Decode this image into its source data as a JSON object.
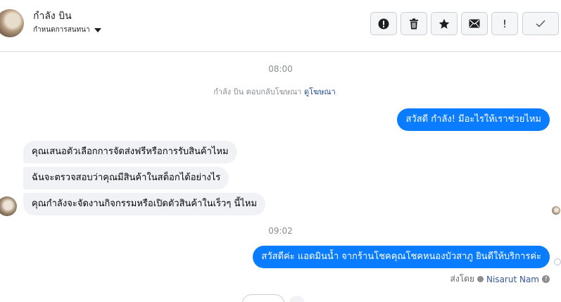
{
  "header": {
    "name": "กำลัง บิน",
    "subtitle": "กำหนดการสนทนา"
  },
  "toolbar": {
    "buttons": [
      {
        "icon": "alert-circle-icon"
      },
      {
        "icon": "trash-icon"
      },
      {
        "icon": "star-icon"
      },
      {
        "icon": "envelope-icon"
      },
      {
        "icon": "exclamation-icon",
        "label": "!"
      },
      {
        "icon": "checkmark-icon"
      }
    ]
  },
  "conversation": {
    "timestamp_1": "08:00",
    "reply_text": "กำลัง บิน ตอบกลับโฆษณา",
    "reply_link": "ดูโฆษณา",
    "outgoing_1": "สวัสดี กำลัง! มีอะไรให้เราช่วยไหม",
    "incoming": [
      "คุณเสนอตัวเลือกการจัดส่งฟรีหรือการรับสินค้าไหม",
      "ฉันจะตรวจสอบว่าคุณมีสินค้าในสต็อกได้อย่างไร",
      "คุณกำลังจะจัดงานกิจกรรมหรือเปิดตัวสินค้าในเร็วๆ นี้ไหม"
    ],
    "timestamp_2": "09:02",
    "outgoing_2": "สวัสดีค่ะ แอดมินน้ำ จากร้านโชคคุณโชคหนองบัวสาภู ยินดีให้บริการค่ะ",
    "sent_by_label": "ส่งโดย",
    "sent_by_name": "Nisarut Nam",
    "help_glyph": "?"
  },
  "colors": {
    "outgoing_bubble": "#0a7cff",
    "incoming_bubble": "#f0f2f5",
    "link": "#1c4a8e"
  }
}
